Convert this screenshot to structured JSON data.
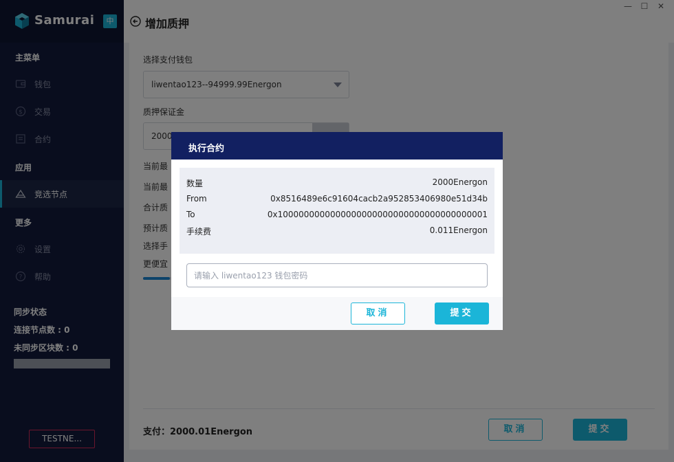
{
  "app": {
    "name": "Samurai",
    "lang_badge": "中"
  },
  "window": {
    "minimize": "—",
    "maximize": "☐",
    "close": "✕"
  },
  "header": {
    "title": "增加质押"
  },
  "sidebar": {
    "main_menu_title": "主菜单",
    "items": [
      {
        "label": "钱包",
        "icon": "wallet-icon"
      },
      {
        "label": "交易",
        "icon": "transaction-icon"
      },
      {
        "label": "合约",
        "icon": "contract-icon"
      }
    ],
    "app_title": "应用",
    "app_items": [
      {
        "label": "竞选节点",
        "icon": "node-icon",
        "active": true
      }
    ],
    "more_title": "更多",
    "more_items": [
      {
        "label": "设置",
        "icon": "gear-icon"
      },
      {
        "label": "帮助",
        "icon": "help-icon"
      }
    ],
    "sync": {
      "title": "同步状态",
      "connected_nodes": "连接节点数 : 0",
      "unsynced_blocks": "未同步区块数 : 0"
    },
    "network_button": "TESTNE..."
  },
  "form": {
    "wallet_label": "选择支付钱包",
    "wallet_value": "liwentao123--94999.99Energon",
    "deposit_label": "质押保证金",
    "deposit_value": "2000",
    "row1_label": "当前最",
    "row2_label": "当前最",
    "row3_label": "合计质",
    "row4_label": "预计质",
    "row5_label": "选择手",
    "cheaper_label": "更便宜",
    "slider_fraction": 0.13
  },
  "footer": {
    "pay_label": "支付：2000.01Energon",
    "cancel": "取消",
    "submit": "提交"
  },
  "modal": {
    "title": "执行合约",
    "rows": [
      {
        "key": "数量",
        "value": "2000Energon"
      },
      {
        "key": "From",
        "value": "0x8516489e6c91604cacb2a952853406980e51d34b"
      },
      {
        "key": "To",
        "value": "0x1000000000000000000000000000000000000001"
      },
      {
        "key": "手续费",
        "value": "0.011Energon"
      }
    ],
    "password_placeholder": "请输入 liwentao123 钱包密码",
    "cancel": "取消",
    "submit": "提交"
  },
  "colors": {
    "accent": "#1bb5d8",
    "sidebar_bg": "#121a3c",
    "modal_header": "#122061",
    "network_border": "#d62d5a"
  }
}
